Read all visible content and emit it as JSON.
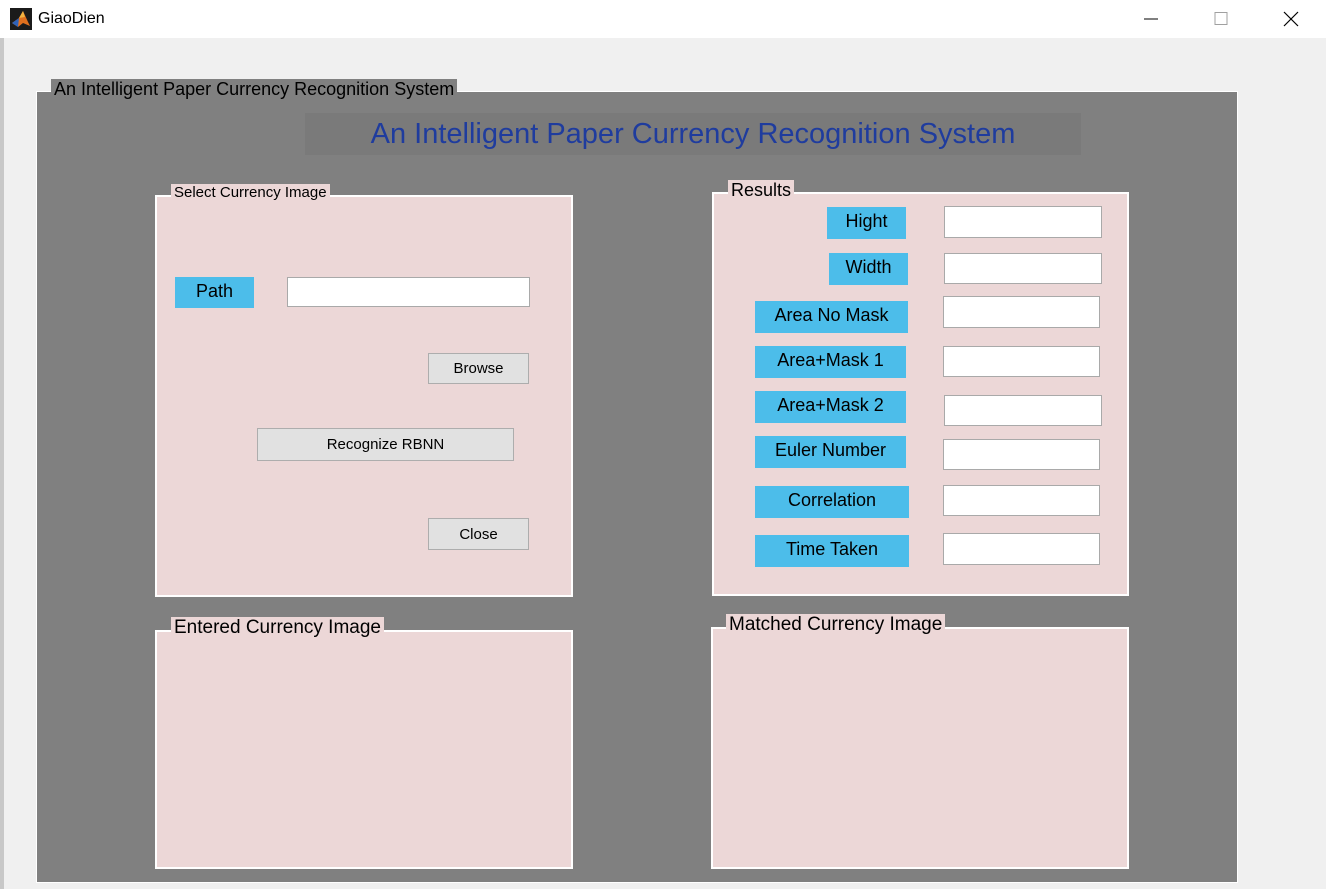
{
  "window": {
    "title": "GiaoDien",
    "icon": "matlab-icon"
  },
  "main_panel": {
    "legend": "An Intelligent Paper Currency Recognition System",
    "heading": "An Intelligent Paper Currency Recognition System"
  },
  "select_group": {
    "legend": "Select Currency Image",
    "path_label": "Path",
    "path_value": "",
    "browse_label": "Browse",
    "recognize_label": "Recognize RBNN",
    "close_label": "Close"
  },
  "results_group": {
    "legend": "Results",
    "rows": [
      {
        "label": "Hight",
        "value": ""
      },
      {
        "label": "Width",
        "value": ""
      },
      {
        "label": "Area No Mask",
        "value": ""
      },
      {
        "label": "Area+Mask 1",
        "value": ""
      },
      {
        "label": "Area+Mask 2",
        "value": ""
      },
      {
        "label": "Euler Number",
        "value": ""
      },
      {
        "label": "Correlation",
        "value": ""
      },
      {
        "label": "Time Taken",
        "value": ""
      }
    ]
  },
  "entered_group": {
    "legend": "Entered Currency Image"
  },
  "matched_group": {
    "legend": "Matched Currency Image"
  },
  "colors": {
    "panel_bg": "#808080",
    "group_bg": "#ecd7d7",
    "label_bg": "#4cbdea",
    "heading_text": "#1f3c9e"
  }
}
